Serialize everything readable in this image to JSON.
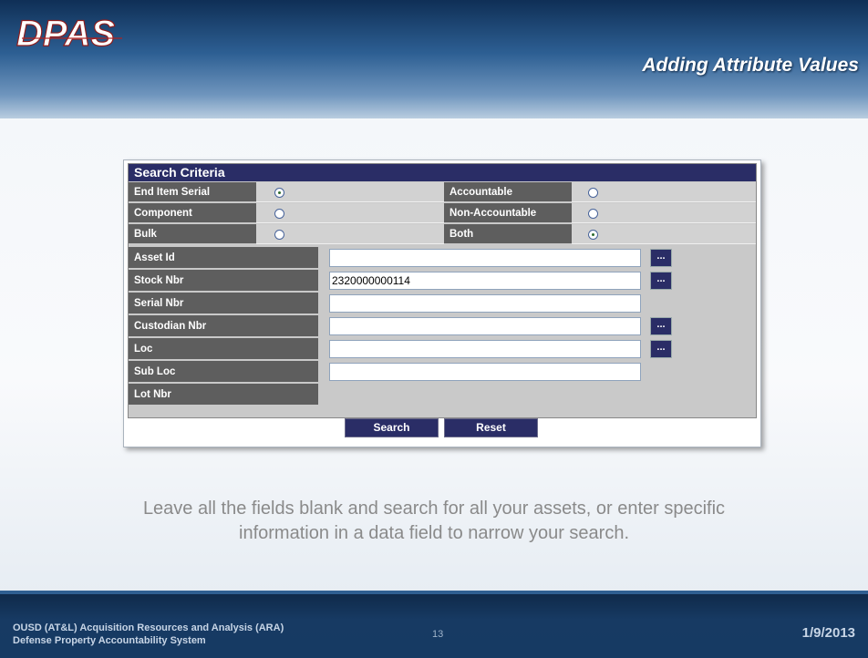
{
  "slide": {
    "logo_text": "DPAS",
    "title": "Adding Attribute Values",
    "caption": "Leave all the fields blank and search for all your assets, or enter specific information in a data field to narrow your search.",
    "footer_line1": "OUSD (AT&L) Acquisition Resources and Analysis (ARA)",
    "footer_line2": "Defense Property Accountability System",
    "page_number": "13",
    "date": "1/9/2013"
  },
  "search": {
    "title": "Search Criteria",
    "radio_rows": [
      {
        "left_label": "End Item Serial",
        "left_checked": true,
        "right_label": "Accountable",
        "right_checked": false
      },
      {
        "left_label": "Component",
        "left_checked": false,
        "right_label": "Non-Accountable",
        "right_checked": false
      },
      {
        "left_label": "Bulk",
        "left_checked": false,
        "right_label": "Both",
        "right_checked": true
      }
    ],
    "fields": [
      {
        "label": "Asset Id",
        "value": "",
        "has_lookup": true
      },
      {
        "label": "Stock Nbr",
        "value": "2320000000114",
        "has_lookup": true
      },
      {
        "label": "Serial Nbr",
        "value": "",
        "has_lookup": false
      },
      {
        "label": "Custodian Nbr",
        "value": "",
        "has_lookup": true
      },
      {
        "label": "Loc",
        "value": "",
        "has_lookup": true
      },
      {
        "label": "Sub Loc",
        "value": "",
        "has_lookup": false
      },
      {
        "label": "Lot Nbr",
        "value": "",
        "has_lookup": false,
        "no_input": true
      }
    ],
    "lookup_label": "...",
    "search_button": "Search",
    "reset_button": "Reset"
  },
  "colors": {
    "header_dark": "#0f2f56",
    "panel_title": "#2a2d66",
    "label_bg": "#5e5e5e"
  }
}
